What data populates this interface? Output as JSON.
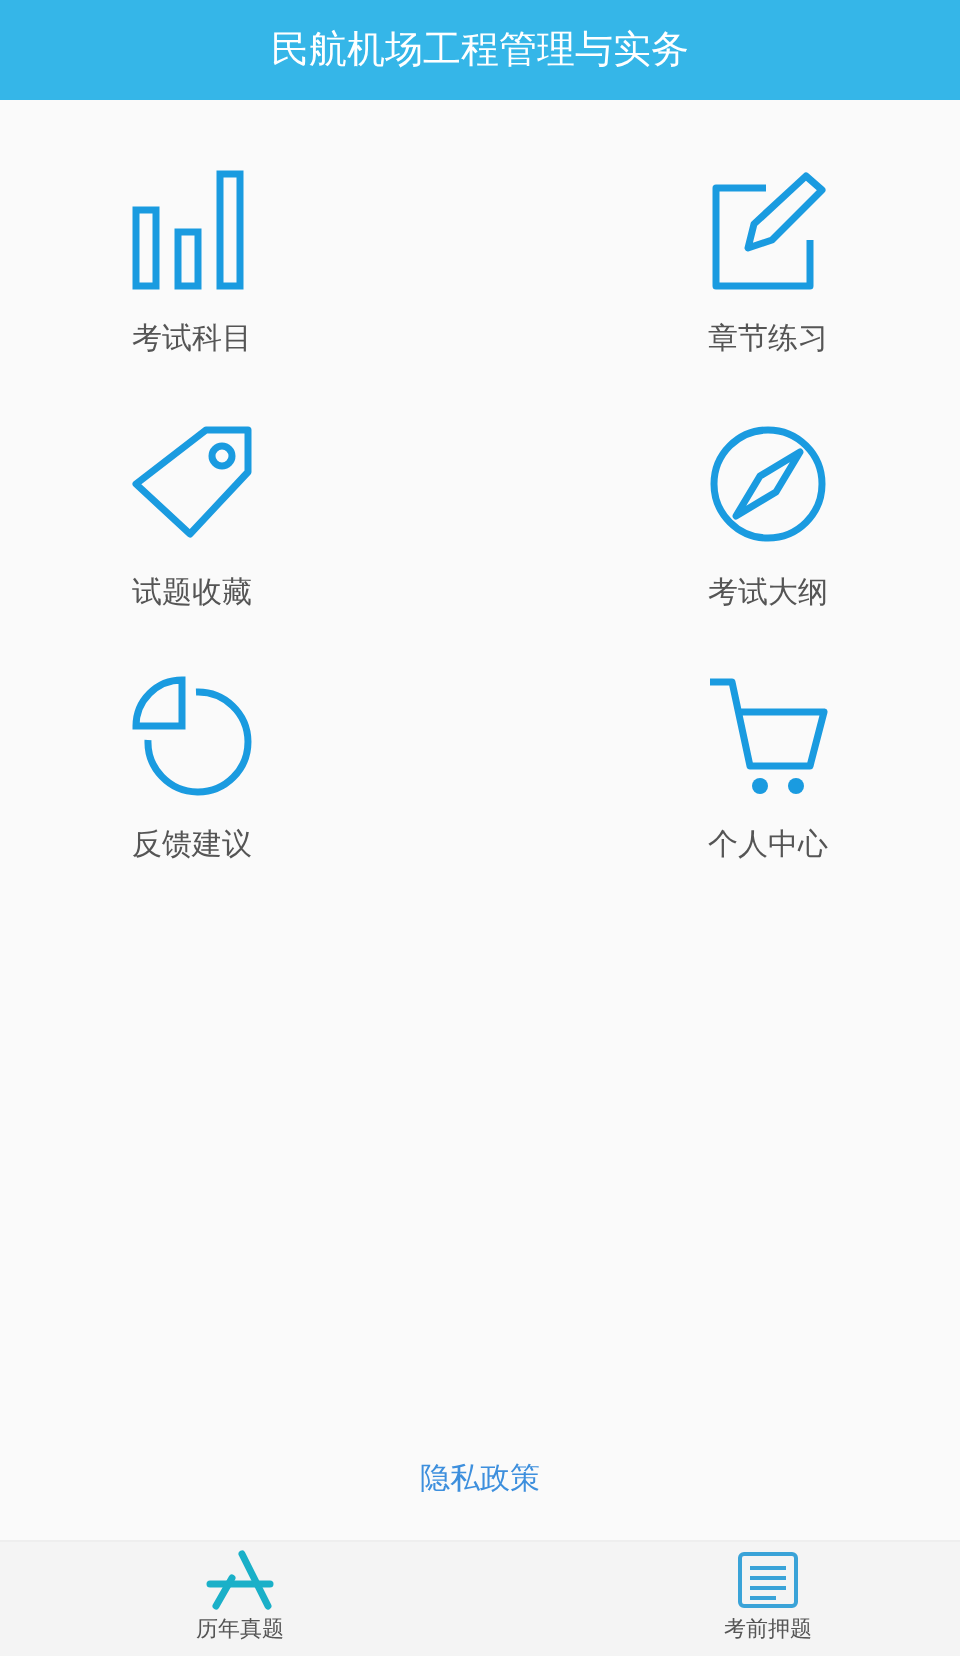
{
  "header": {
    "title": "民航机场工程管理与实务"
  },
  "menu": [
    {
      "label": "考试科目",
      "kind": "bars"
    },
    {
      "label": "章节练习",
      "kind": "edit"
    },
    {
      "label": "试题收藏",
      "kind": "tag"
    },
    {
      "label": "考试大纲",
      "kind": "compass"
    },
    {
      "label": "反馈建议",
      "kind": "pie"
    },
    {
      "label": "个人中心",
      "kind": "cart"
    }
  ],
  "privacy_link": "隐私政策",
  "bottom_tabs": [
    {
      "label": "历年真题",
      "kind": "appstore"
    },
    {
      "label": "考前押题",
      "kind": "document"
    }
  ]
}
